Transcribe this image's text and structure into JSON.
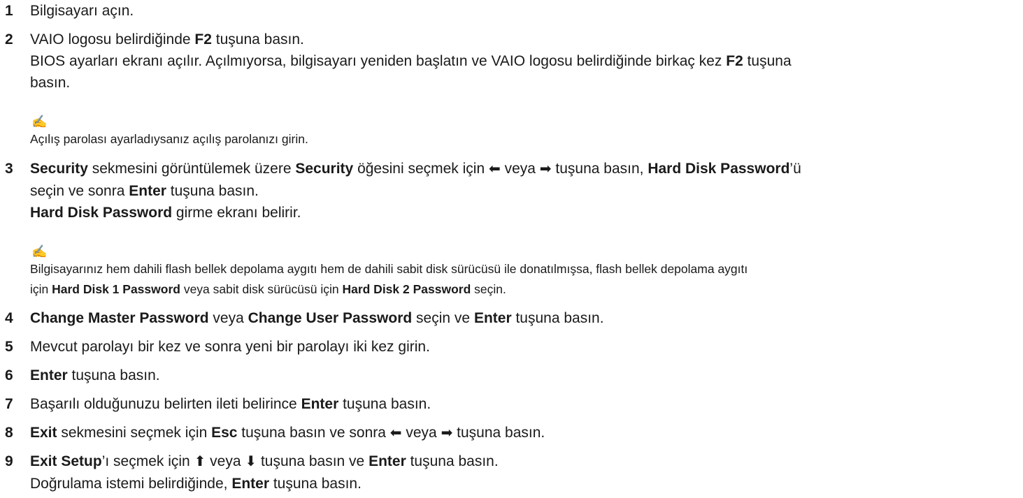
{
  "steps": [
    {
      "num": "1",
      "lines": [
        [
          {
            "t": "Bilgisayarı açın."
          }
        ]
      ]
    },
    {
      "num": "2",
      "lines": [
        [
          {
            "t": "VAIO logosu belirdiğinde "
          },
          {
            "t": "F2",
            "b": true
          },
          {
            "t": " tuşuna basın."
          }
        ],
        [
          {
            "t": "BIOS ayarları ekranı açılır. Açılmıyorsa, bilgisayarı yeniden başlatın ve VAIO logosu belirdiğinde birkaç kez "
          },
          {
            "t": "F2",
            "b": true
          },
          {
            "t": " tuşuna"
          }
        ],
        [
          {
            "t": "basın."
          }
        ]
      ]
    },
    {
      "num": "3",
      "lines": [
        [
          {
            "t": "Security",
            "b": true
          },
          {
            "t": " sekmesini görüntülemek üzere "
          },
          {
            "t": "Security",
            "b": true
          },
          {
            "t": " öğesini seçmek için "
          },
          {
            "t": "⬅",
            "a": true
          },
          {
            "t": " veya "
          },
          {
            "t": "➡",
            "a": true
          },
          {
            "t": " tuşuna basın, "
          },
          {
            "t": "Hard Disk Password",
            "b": true
          },
          {
            "t": "’ü"
          }
        ],
        [
          {
            "t": "seçin ve sonra "
          },
          {
            "t": "Enter",
            "b": true
          },
          {
            "t": " tuşuna basın."
          }
        ],
        [
          {
            "t": "Hard Disk Password",
            "b": true
          },
          {
            "t": " girme ekranı belirir."
          }
        ]
      ]
    },
    {
      "num": "4",
      "lines": [
        [
          {
            "t": "Change Master Password",
            "b": true
          },
          {
            "t": " veya "
          },
          {
            "t": "Change User Password",
            "b": true
          },
          {
            "t": " seçin ve "
          },
          {
            "t": "Enter",
            "b": true
          },
          {
            "t": " tuşuna basın."
          }
        ]
      ]
    },
    {
      "num": "5",
      "lines": [
        [
          {
            "t": "Mevcut parolayı bir kez ve sonra yeni bir parolayı iki kez girin."
          }
        ]
      ]
    },
    {
      "num": "6",
      "lines": [
        [
          {
            "t": "Enter",
            "b": true
          },
          {
            "t": " tuşuna basın."
          }
        ]
      ]
    },
    {
      "num": "7",
      "lines": [
        [
          {
            "t": "Başarılı olduğunuzu belirten ileti belirince "
          },
          {
            "t": "Enter",
            "b": true
          },
          {
            "t": " tuşuna basın."
          }
        ]
      ]
    },
    {
      "num": "8",
      "lines": [
        [
          {
            "t": "Exit",
            "b": true
          },
          {
            "t": " sekmesini seçmek için "
          },
          {
            "t": "Esc",
            "b": true
          },
          {
            "t": " tuşuna basın ve sonra "
          },
          {
            "t": "⬅",
            "a": true
          },
          {
            "t": " veya "
          },
          {
            "t": "➡",
            "a": true
          },
          {
            "t": " tuşuna basın."
          }
        ]
      ]
    },
    {
      "num": "9",
      "lines": [
        [
          {
            "t": "Exit Setup",
            "b": true
          },
          {
            "t": "’ı seçmek için "
          },
          {
            "t": "⬆",
            "a": true
          },
          {
            "t": " veya "
          },
          {
            "t": "⬇",
            "a": true
          },
          {
            "t": " tuşuna basın ve "
          },
          {
            "t": "Enter",
            "b": true
          },
          {
            "t": " tuşuna basın."
          }
        ],
        [
          {
            "t": "Doğrulama istemi belirdiğinde, "
          },
          {
            "t": "Enter",
            "b": true
          },
          {
            "t": " tuşuna basın."
          }
        ]
      ]
    }
  ],
  "notes": [
    {
      "icon": "note-pen-icon",
      "lines": [
        [
          {
            "t": "Açılış parolası ayarladıysanız açılış parolanızı girin."
          }
        ]
      ]
    },
    {
      "icon": "note-pen-icon",
      "lines": [
        [
          {
            "t": "Bilgisayarınız hem dahili flash bellek depolama aygıtı hem de dahili sabit disk sürücüsü ile donatılmışsa, flash bellek depolama aygıtı"
          }
        ],
        [
          {
            "t": "için "
          },
          {
            "t": "Hard Disk 1 Password",
            "b": true
          },
          {
            "t": " veya sabit disk sürücüsü için "
          },
          {
            "t": "Hard Disk 2 Password",
            "b": true
          },
          {
            "t": " seçin."
          }
        ]
      ]
    }
  ]
}
